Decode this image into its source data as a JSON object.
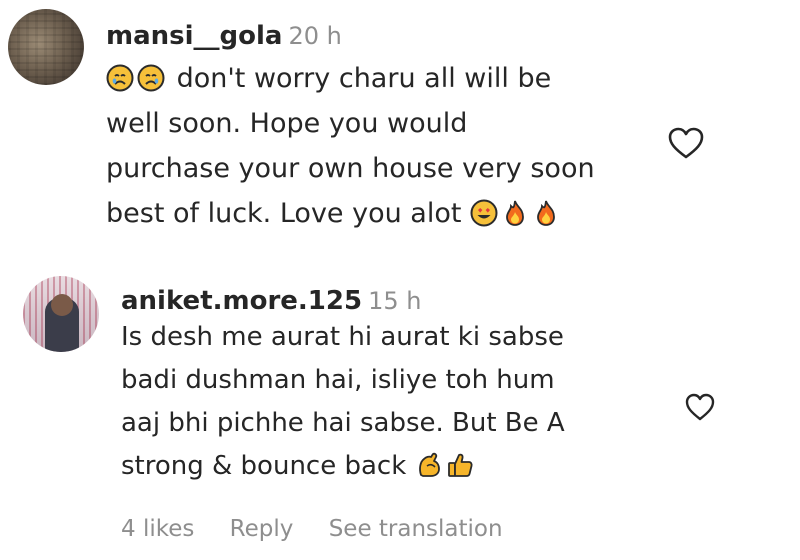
{
  "comments": [
    {
      "username": "mansi__gola",
      "time": "20 h",
      "lines": [
        "don't worry charu all will be",
        "well soon. Hope you would",
        "purchase your own house very soon",
        "best of luck. Love you alot"
      ],
      "emoji": {
        "line1_prefix": [
          "crying-face",
          "crying-face"
        ],
        "line4_suffix": [
          "heart-eyes-face",
          "fire",
          "fire"
        ]
      }
    },
    {
      "username": "aniket.more.125",
      "time": "15 h",
      "lines": [
        "Is desh me aurat hi aurat ki sabse",
        "badi dushman hai, isliye toh hum",
        "aaj bhi pichhe hai sabse. But Be A",
        "strong & bounce back"
      ],
      "emoji": {
        "line4_suffix": [
          "flexed-biceps",
          "thumbs-up"
        ]
      },
      "actions": {
        "likes": "4 likes",
        "reply": "Reply",
        "translate": "See translation"
      }
    }
  ],
  "colors": {
    "text": "#262626",
    "muted": "#8e8e8e",
    "emoji_yellow": "#f6b52a",
    "fire": "#f26b1d"
  }
}
